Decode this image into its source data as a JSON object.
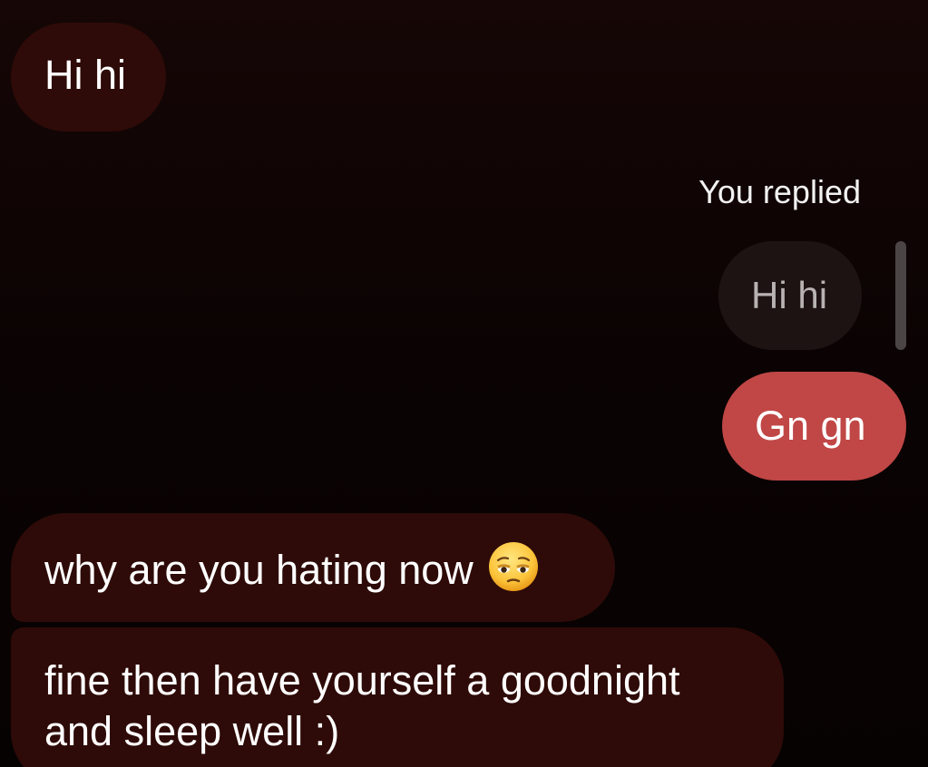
{
  "conversation": {
    "messages": [
      {
        "text": "Hi hi"
      },
      {
        "reply_label": "You replied",
        "quoted_text": "Hi hi",
        "text": "Gn gn"
      },
      {
        "text": "why are you hating now",
        "emoji": "pensive-face-emoji"
      },
      {
        "lines": [
          "fine then have yourself a goodnight",
          "and sleep well :)"
        ]
      }
    ]
  },
  "colors": {
    "incoming_bubble": "#2e0b08",
    "outgoing_bubble": "#c04746",
    "quoted_bubble": "#1d1312",
    "background": "#0b0303"
  }
}
